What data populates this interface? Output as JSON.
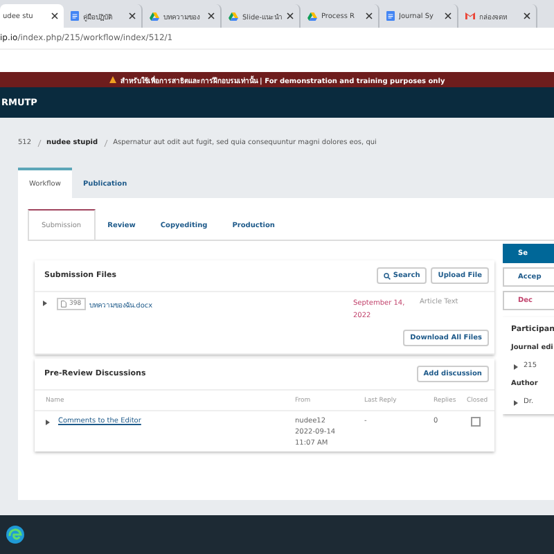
{
  "browser_tabs": [
    {
      "kind": "page",
      "title": "udee stu",
      "selected": true
    },
    {
      "kind": "doc",
      "title": "คู่มือปฏิบัติ",
      "selected": false
    },
    {
      "kind": "drive",
      "title": "บทความของ",
      "selected": false
    },
    {
      "kind": "drive",
      "title": "Slide-แนะนำ",
      "selected": false
    },
    {
      "kind": "drive",
      "title": "Process R",
      "selected": false
    },
    {
      "kind": "doc",
      "title": "Journal Sy",
      "selected": false
    },
    {
      "kind": "mail",
      "title": "กล่องจดห",
      "selected": false
    }
  ],
  "address_bar": {
    "host": "ip.io",
    "path": "/index.php/215/workflow/index/512/1"
  },
  "banner": "สำหรับใช้เพื่อการสาธิตและการฝึกอบรมเท่านั้น | For demonstration and training purposes only",
  "navbar": {
    "title": "RMUTP"
  },
  "breadcrumb": {
    "id": "512",
    "author": "nudee stupid",
    "title": "Aspernatur aut odit aut fugit, sed quia consequuntur magni dolores eos, qui"
  },
  "tabs": [
    {
      "label": "Workflow",
      "selected": true
    },
    {
      "label": "Publication",
      "selected": false
    }
  ],
  "stage_tabs": [
    {
      "label": "Submission",
      "selected": true
    },
    {
      "label": "Review",
      "selected": false
    },
    {
      "label": "Copyediting",
      "selected": false
    },
    {
      "label": "Production",
      "selected": false
    }
  ],
  "submission_files": {
    "title": "Submission Files",
    "buttons": [
      "Search",
      "Upload File"
    ],
    "files": [
      {
        "id": "398",
        "name": "บทความของฉัน.docx",
        "date": "September 14, 2022",
        "type": "Article Text"
      }
    ],
    "download_button": "Download All Files"
  },
  "discussions": {
    "title": "Pre-Review Discussions",
    "button": "Add discussion",
    "columns": [
      "Name",
      "From",
      "Last Reply",
      "Replies",
      "Closed"
    ],
    "rows": [
      {
        "name": "Comments to the Editor",
        "from": [
          "nudee12",
          "2022-09-14",
          "11:07 AM"
        ],
        "last_reply": "-",
        "replies": "0",
        "closed": false
      }
    ]
  },
  "actions": [
    {
      "label": "Se",
      "kind": "primary"
    },
    {
      "label": "Accep",
      "kind": "default"
    },
    {
      "label": "Dec",
      "kind": "danger"
    }
  ],
  "participants": {
    "title": "Participan",
    "groups": [
      {
        "name": "Journal edi",
        "members": [
          "215"
        ]
      },
      {
        "name": "Author",
        "members": [
          "Dr."
        ]
      }
    ]
  }
}
